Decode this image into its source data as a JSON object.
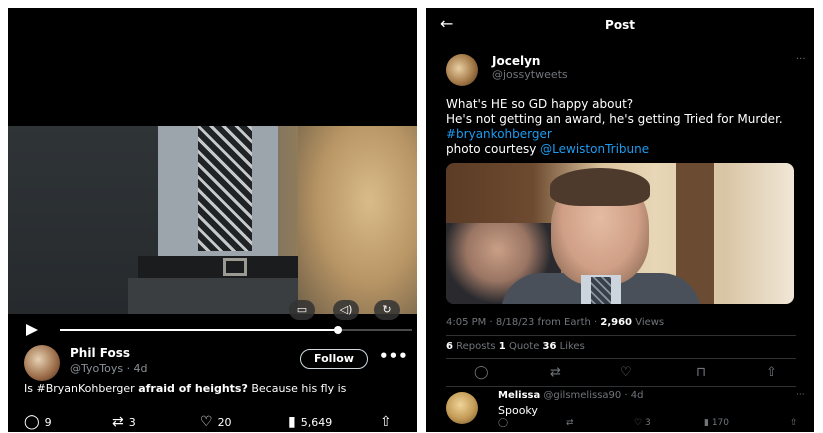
{
  "left_post": {
    "video": {
      "progress": 0.79,
      "controls": {
        "pip_icon": "pip-icon",
        "volume_icon": "volume-icon",
        "replay_icon": "replay-icon"
      }
    },
    "author": {
      "name": "Phil Foss",
      "handle_time": "@TyoToys · 4d"
    },
    "follow_label": "Follow",
    "more_label": "•••",
    "text_prefix": "Is #BryanKohberger ",
    "text_bold": "afraid of heights?",
    "text_suffix": " Because his fly is",
    "actions": {
      "replies": "9",
      "reposts": "3",
      "likes": "20",
      "views": "5,649"
    }
  },
  "right_post": {
    "header": {
      "back_icon": "back-arrow-icon",
      "title": "Post"
    },
    "author": {
      "name": "Jocelyn",
      "handle": "@jossytweets",
      "more": "···"
    },
    "text": {
      "line1": "What's HE so GD happy about?",
      "line2": "He's not getting an award, he's getting Tried for Murder. ",
      "hashtag": "#bryankohberger",
      "line3": "photo courtesy ",
      "mention": "@LewistonTribune"
    },
    "meta": {
      "time_location": "4:05 PM · 8/18/23 from Earth · ",
      "views_count": "2,960",
      "views_label": " Views"
    },
    "stats": {
      "reposts_count": "6",
      "reposts_label": " Reposts  ",
      "quotes_count": "1",
      "quotes_label": " Quote  ",
      "likes_count": "36",
      "likes_label": " Likes"
    },
    "reply": {
      "name": "Melissa",
      "handle_time": " @gilsmelissa90 · 4d",
      "text": "Spooky",
      "more": "···",
      "likes": "3",
      "views": "170"
    }
  },
  "colors": {
    "background": "#000000",
    "link_blue": "#1d9bf0",
    "muted_gray": "#71767b"
  }
}
